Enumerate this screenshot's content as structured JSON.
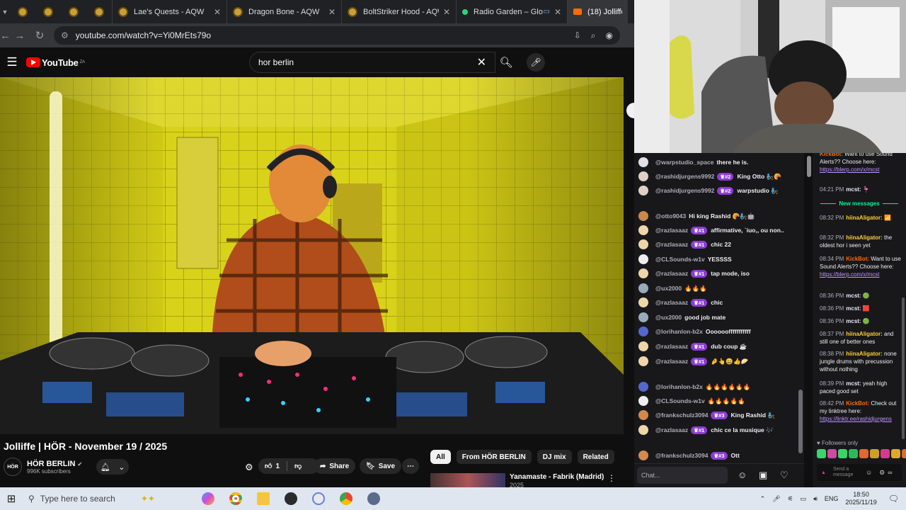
{
  "browser": {
    "tabs": [
      {
        "label": "Lae's Quests - AQW"
      },
      {
        "label": "Dragon Bone - AQW"
      },
      {
        "label": "BoltStriker Hood - AQW"
      },
      {
        "label": "Radio Garden – Glob"
      },
      {
        "label": "(18) Jolliffe | HÖ"
      }
    ],
    "url": "youtube.com/watch?v=Yi0MrEts79o"
  },
  "youtube": {
    "logo": "YouTube",
    "region": "ZA",
    "search_value": "hor berlin",
    "video": {
      "title": "Jolliffe | HÖR - November 19 / 2025",
      "channel_avatar": "HÖR",
      "channel_name": "HÖR BERLIN",
      "subscribers": "996K subscribers",
      "like_count": "1",
      "share_label": "Share",
      "save_label": "Save"
    },
    "chips": [
      "All",
      "From HÖR BERLIN",
      "DJ mix",
      "Related"
    ],
    "recommendation": {
      "title": "Yanamaste - Fabrik (Madrid)",
      "subtitle": "2025"
    }
  },
  "chat_left": {
    "messages": [
      {
        "user": "@warpstudio_space",
        "badge": "",
        "text": "there he is."
      },
      {
        "user": "@rashidjurgens9992",
        "badge": "#2",
        "text": "King Otto 🧞🥐"
      },
      {
        "user": "@rashidjurgens9992",
        "badge": "#2",
        "text": "warpstudio 🧞"
      },
      {
        "user": "@otto9043",
        "badge": "",
        "text": "Hi king Rashid 🥐🧞🤖"
      },
      {
        "user": "@razlasaaz",
        "badge": "#1",
        "text": "affirmative, `iuo,, ou non.."
      },
      {
        "user": "@razlasaaz",
        "badge": "#1",
        "text": "chic 22"
      },
      {
        "user": "@CLSounds-w1v",
        "badge": "",
        "text": "YESSSS"
      },
      {
        "user": "@razlasaaz",
        "badge": "#1",
        "text": "tap mode, iso"
      },
      {
        "user": "@ux2000",
        "badge": "",
        "text": "🔥🔥🔥"
      },
      {
        "user": "@razlasaaz",
        "badge": "#1",
        "text": "chic"
      },
      {
        "user": "@ux2000",
        "badge": "",
        "text": "good job mate"
      },
      {
        "user": "@lorihanlon-b2x",
        "badge": "",
        "text": "Oooooofffffffffff"
      },
      {
        "user": "@razlasaaz",
        "badge": "#1",
        "text": "dub coup ☕"
      },
      {
        "user": "@razlasaaz",
        "badge": "#1",
        "text": "🤌👆😄👍🥟"
      },
      {
        "user": "@lorihanlon-b2x",
        "badge": "",
        "text": "🔥🔥🔥🔥🔥🔥"
      },
      {
        "user": "@CLSounds-w1v",
        "badge": "",
        "text": "🔥🔥🔥🔥🔥"
      },
      {
        "user": "@frankschulz3094",
        "badge": "#3",
        "text": "King Rashid 🧞"
      },
      {
        "user": "@razlasaaz",
        "badge": "#1",
        "text": "chic ce la musique 🎶"
      },
      {
        "user": "@frankschulz3094",
        "badge": "#3",
        "text": "Ott"
      }
    ],
    "input_placeholder": "Chat..."
  },
  "chat_right": {
    "new_messages_label": "New messages",
    "messages": [
      {
        "time": "",
        "user": "KickBot:",
        "text": "Want to use Sound Alerts?? Choose here:",
        "link": "https://blerp.com/x/mcst"
      },
      {
        "time": "04:21 PM",
        "user": "mcst:",
        "text": "🦩",
        "link": ""
      },
      {
        "time": "08:32 PM",
        "user": "hiinaAligator:",
        "text": "📶",
        "link": ""
      },
      {
        "time": "08:32 PM",
        "user": "hiinaAligator:",
        "text": "the oldest hor i seen yet",
        "link": ""
      },
      {
        "time": "08:34 PM",
        "user": "KickBot:",
        "text": "Want to use Sound Alerts?? Choose here:",
        "link": "https://blerp.com/x/mcst"
      },
      {
        "time": "08:36 PM",
        "user": "mcst:",
        "text": "🟢",
        "link": ""
      },
      {
        "time": "08:36 PM",
        "user": "mcst:",
        "text": "🟥",
        "link": ""
      },
      {
        "time": "08:36 PM",
        "user": "mcst:",
        "text": "🟢",
        "link": ""
      },
      {
        "time": "08:37 PM",
        "user": "hiinaAligator:",
        "text": "and still one of better ones",
        "link": ""
      },
      {
        "time": "08:38 PM",
        "user": "hiinaAligator:",
        "text": "none jungle drums with precussion without nothing",
        "link": ""
      },
      {
        "time": "08:39 PM",
        "user": "mcst:",
        "text": "yeah high paced good set",
        "link": ""
      },
      {
        "time": "08:42 PM",
        "user": "KickBot:",
        "text": "Check out my linktree here:",
        "link": "https://linktr.ee/rashidjurgens"
      }
    ],
    "followers_only": "Followers only",
    "send_label": "Send a message"
  },
  "taskbar": {
    "search_placeholder": "Type here to search",
    "lang": "ENG",
    "time": "18:50",
    "date": "2025/11/19"
  }
}
